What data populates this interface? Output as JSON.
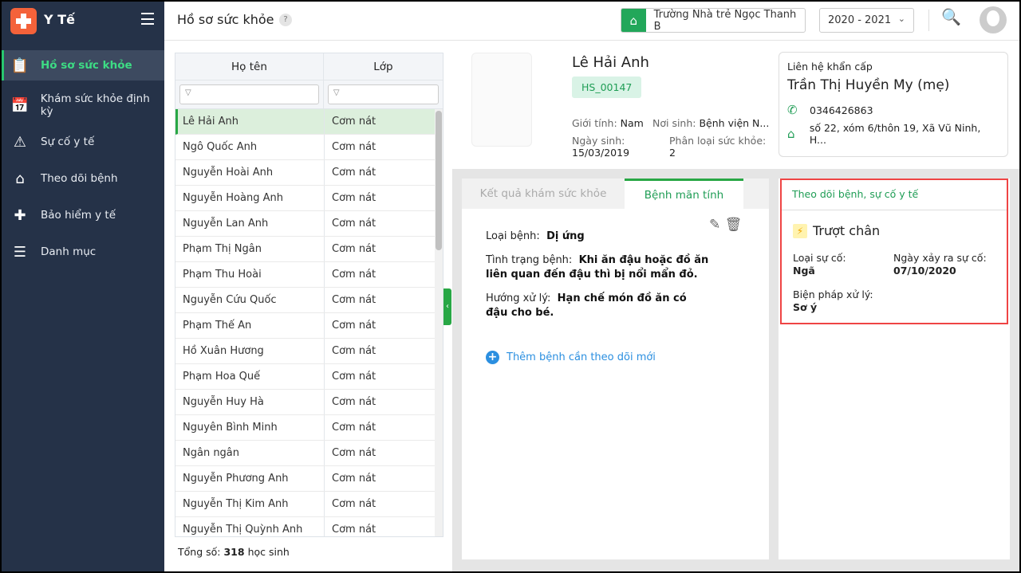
{
  "app": {
    "title": "Y Tế"
  },
  "sidebar": {
    "items": [
      {
        "label": "Hồ sơ sức khỏe",
        "icon": "clipboard-user-icon",
        "active": true
      },
      {
        "label": "Khám sức khỏe định kỳ",
        "icon": "calendar-check-icon"
      },
      {
        "label": "Sự cố y tế",
        "icon": "warning-icon"
      },
      {
        "label": "Theo dõi bệnh",
        "icon": "house-icon"
      },
      {
        "label": "Bảo hiểm y tế",
        "icon": "medical-bag-icon"
      },
      {
        "label": "Danh mục",
        "icon": "folder-list-icon"
      }
    ]
  },
  "header": {
    "title": "Hồ sơ sức khỏe",
    "help": "?",
    "school": "Trường Nhà trẻ Ngọc Thanh B",
    "year": "2020 - 2021"
  },
  "table": {
    "columns": [
      "Họ tên",
      "Lớp"
    ],
    "rows": [
      [
        "Lê Hải Anh",
        "Cơm nát"
      ],
      [
        "Ngô Quốc Anh",
        "Cơm nát"
      ],
      [
        "Nguyễn Hoài Anh",
        "Cơm nát"
      ],
      [
        "Nguyễn Hoàng Anh",
        "Cơm nát"
      ],
      [
        "Nguyễn Lan Anh",
        "Cơm nát"
      ],
      [
        "Phạm Thị Ngân",
        "Cơm nát"
      ],
      [
        "Phạm Thu Hoài",
        "Cơm nát"
      ],
      [
        "Nguyễn Cứu Quốc",
        "Cơm nát"
      ],
      [
        "Phạm Thế An",
        "Cơm nát"
      ],
      [
        "Hồ Xuân Hương",
        "Cơm nát"
      ],
      [
        "Phạm Hoa Quế",
        "Cơm nát"
      ],
      [
        "Nguyễn Huy Hà",
        "Cơm nát"
      ],
      [
        "Nguyên Bình Minh",
        "Cơm nát"
      ],
      [
        "Ngân ngân",
        "Cơm nát"
      ],
      [
        "Nguyễn Phương Anh",
        "Cơm nát"
      ],
      [
        "Nguyễn Thị Kim Anh",
        "Cơm nát"
      ],
      [
        "Nguyễn Thị Quỳnh Anh",
        "Cơm nát"
      ]
    ],
    "total_label": "Tổng số:",
    "total": "318",
    "total_unit": "học sinh"
  },
  "profile": {
    "name": "Lê Hải Anh",
    "code": "HS_00147",
    "gender_label": "Giới tính:",
    "gender": "Nam",
    "birthplace_label": "Nơi sinh:",
    "birthplace": "Bệnh viện N...",
    "dob_label": "Ngày sinh:",
    "dob": "15/03/2019",
    "health_label": "Phân loại sức khỏe:",
    "health": "2"
  },
  "contact": {
    "label": "Liên hệ khẩn cấp",
    "name": "Trần Thị Huyền My (mẹ)",
    "phone": "0346426863",
    "address": "số 22, xóm 6/thôn 19, Xã Vũ Ninh, H..."
  },
  "tabs": [
    {
      "label": "Kết quả khám sức khỏe"
    },
    {
      "label": "Bệnh mãn tính",
      "active": true
    }
  ],
  "disease": {
    "type_label": "Loại bệnh:",
    "type": "Dị ứng",
    "status_label": "Tình trạng bệnh:",
    "status": "Khi ăn đậu hoặc đồ ăn liên quan đến đậu thì bị nổi mẩn đỏ.",
    "treat_label": "Hướng xử lý:",
    "treat": "Hạn chế món đồ ăn có đậu cho bé.",
    "add": "Thêm bệnh cần theo dõi mới"
  },
  "incident": {
    "header": "Theo dõi bệnh, sự cố y tế",
    "title": "Trượt chân",
    "type_label": "Loại sự cố:",
    "type": "Ngã",
    "date_label": "Ngày xảy ra sự cố:",
    "date": "07/10/2020",
    "measure_label": "Biện pháp xử lý:",
    "measure": "Sơ ý"
  },
  "colors": {
    "sidebar": "#253248",
    "accent": "#28a745",
    "highlight": "#ef4444"
  }
}
